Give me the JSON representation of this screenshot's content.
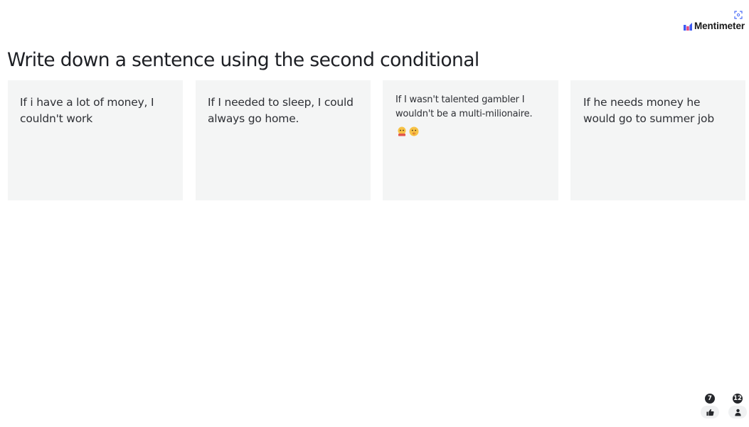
{
  "header": {
    "brand_name": "Mentimeter",
    "fullscreen_icon": "fullscreen-icon",
    "logo_icon": "mentimeter-bars-logo"
  },
  "question": {
    "title": "Write down a sentence using the second conditional"
  },
  "responses": [
    {
      "text": "If i have a lot of money, I couldn't work"
    },
    {
      "text": "If I needed to sleep, I could always go home."
    },
    {
      "text": "If I wasn't talented gambler I wouldn't be a multi-milionaire.",
      "emoji": [
        "money-face-emoji",
        "shushing-face-emoji"
      ]
    },
    {
      "text": "If he needs money he would go to summer job"
    }
  ],
  "footer": {
    "reactions_count": "7",
    "reactions_icon": "thumbs-up-icon",
    "participants_count": "12",
    "participants_icon": "person-icon"
  },
  "colors": {
    "card_background": "#f4f5f5",
    "logo_blue": "#3f5bf2",
    "logo_pink": "#e8457c",
    "badge_dark": "#25272b"
  }
}
